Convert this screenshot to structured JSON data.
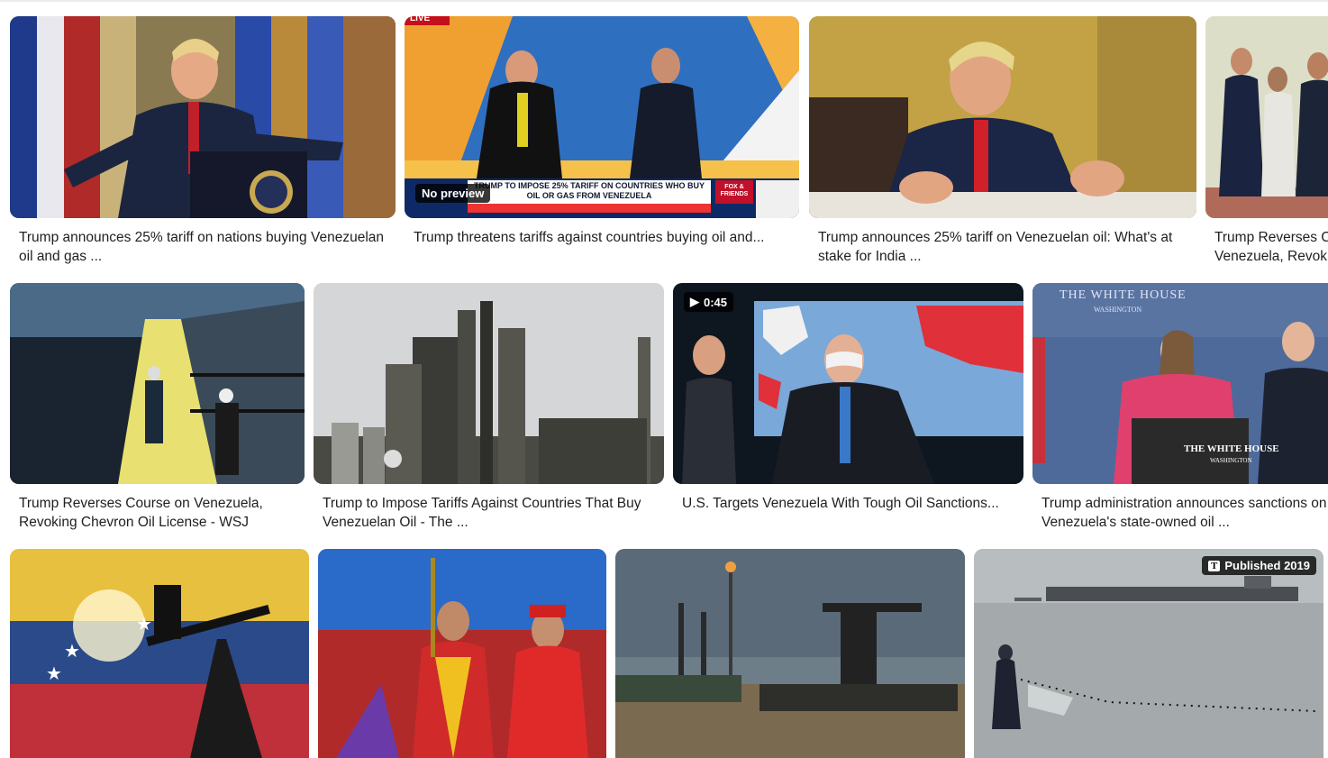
{
  "results": [
    {
      "caption": "Trump announces 25% tariff on nations buying Venezuelan oil and gas ..."
    },
    {
      "caption": "Trump threatens tariffs against countries buying oil and...",
      "badge": "No preview",
      "banner": "TRUMP TO IMPOSE 25% TARIFF ON COUNTRIES WHO BUY OIL OR GAS FROM VENEZUELA",
      "live": "LIVE",
      "logo": "FOX & FRIENDS"
    },
    {
      "caption": "Trump announces 25% tariff on Venezuelan oil: What's at stake for India ..."
    },
    {
      "caption": "Trump Reverses Course on Venezuela, Revoking Chevron Oil License - WSJ"
    },
    {
      "caption": "Trump Reverses Course on Venezuela, Revoking Chevron Oil License - WSJ"
    },
    {
      "caption": "Trump to Impose Tariffs Against Countries That Buy Venezuelan Oil - The ..."
    },
    {
      "caption": "U.S. Targets Venezuela With Tough Oil Sanctions...",
      "duration": "0:45"
    },
    {
      "caption": "Trump administration announces sanctions on Venezuela's state-owned oil ...",
      "sign_top": "THE WHITE HOUSE",
      "sign_top_sub": "WASHINGTON",
      "podium": "THE WHITE HOUSE",
      "podium_sub": "WASHINGTON"
    },
    {
      "caption": ""
    },
    {
      "caption": ""
    },
    {
      "caption": ""
    },
    {
      "caption": "",
      "badge": "Published 2019",
      "badge_logo": "T"
    }
  ]
}
